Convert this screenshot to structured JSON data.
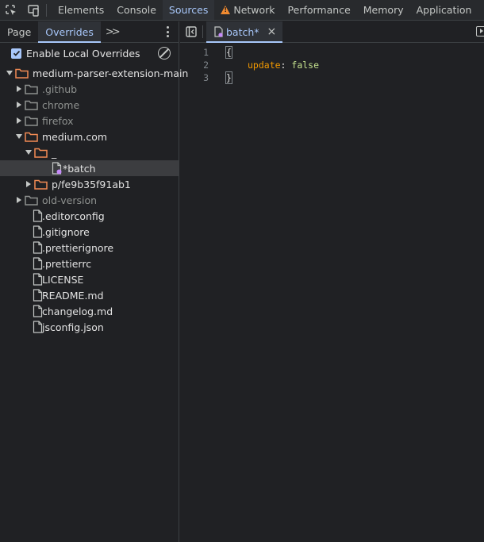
{
  "top_tabs": [
    {
      "label": "Elements"
    },
    {
      "label": "Console"
    },
    {
      "label": "Sources",
      "active": true
    },
    {
      "label": "Network",
      "warning": true
    },
    {
      "label": "Performance"
    },
    {
      "label": "Memory"
    },
    {
      "label": "Application"
    }
  ],
  "navigator": {
    "tabs": [
      {
        "label": "Page"
      },
      {
        "label": "Overrides",
        "active": true
      }
    ],
    "more_label": ">>",
    "enable_overrides_label": "Enable Local Overrides",
    "enable_overrides_checked": true
  },
  "tree": [
    {
      "label": "medium-parser-extension-main",
      "depth": 0,
      "type": "folder",
      "expanded": true,
      "dim": false
    },
    {
      "label": ".github",
      "depth": 1,
      "type": "folder",
      "expanded": false,
      "dim": true
    },
    {
      "label": "chrome",
      "depth": 1,
      "type": "folder",
      "expanded": false,
      "dim": true
    },
    {
      "label": "firefox",
      "depth": 1,
      "type": "folder",
      "expanded": false,
      "dim": true
    },
    {
      "label": "medium.com",
      "depth": 1,
      "type": "folder",
      "expanded": true,
      "dim": false
    },
    {
      "label": "_",
      "depth": 2,
      "type": "folder",
      "expanded": true,
      "dim": false
    },
    {
      "label": "*batch",
      "depth": 3,
      "type": "file-modified",
      "selected": true,
      "dim": false
    },
    {
      "label": "p/fe9b35f91ab1",
      "depth": 2,
      "type": "folder",
      "expanded": false,
      "dim": false
    },
    {
      "label": "old-version",
      "depth": 1,
      "type": "folder",
      "expanded": false,
      "dim": true
    },
    {
      "label": ".editorconfig",
      "depth": 1,
      "type": "file",
      "dim": false
    },
    {
      "label": ".gitignore",
      "depth": 1,
      "type": "file",
      "dim": false
    },
    {
      "label": ".prettierignore",
      "depth": 1,
      "type": "file",
      "dim": false
    },
    {
      "label": ".prettierrc",
      "depth": 1,
      "type": "file",
      "dim": false
    },
    {
      "label": "LICENSE",
      "depth": 1,
      "type": "file",
      "dim": false
    },
    {
      "label": "README.md",
      "depth": 1,
      "type": "file",
      "dim": false
    },
    {
      "label": "changelog.md",
      "depth": 1,
      "type": "file",
      "dim": false
    },
    {
      "label": "jsconfig.json",
      "depth": 1,
      "type": "file",
      "dim": false
    }
  ],
  "editor": {
    "tab_label": "batch*",
    "close_label": "×",
    "lines": [
      {
        "num": "1",
        "text": "{"
      },
      {
        "num": "2",
        "key": "update",
        "sep": ": ",
        "value": "false"
      },
      {
        "num": "3",
        "text": "}"
      }
    ]
  },
  "colors": {
    "accent": "#a8c7fa",
    "folder": "#f28b54",
    "warning": "#f28b30",
    "modified_dot": "#c58af9"
  }
}
